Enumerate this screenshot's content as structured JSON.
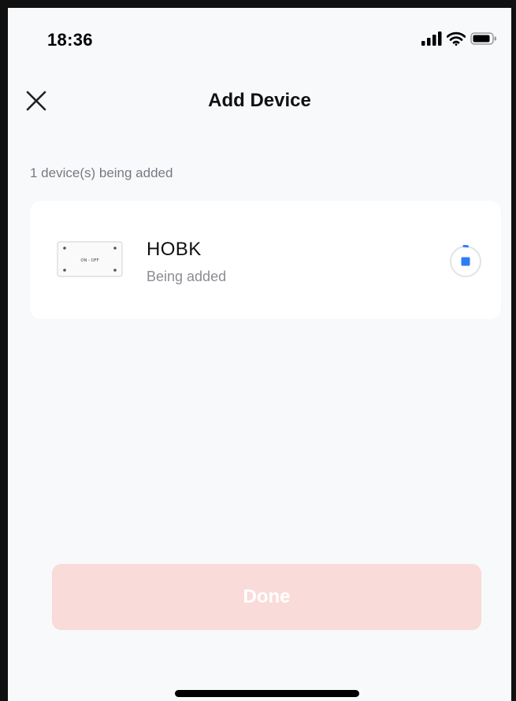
{
  "status_bar": {
    "time": "18:36",
    "icons": [
      "signal-icon",
      "wifi-icon",
      "battery-icon"
    ]
  },
  "header": {
    "title": "Add Device",
    "close_icon": "close-icon"
  },
  "section_label": "1 device(s) being added",
  "device": {
    "name": "HOBK",
    "status": "Being added",
    "thumbnail_label": "ON - OFF",
    "progress_icon": "progress-icon"
  },
  "done_button": {
    "label": "Done",
    "enabled": false
  },
  "colors": {
    "background": "#f8f9fb",
    "card": "#ffffff",
    "accent_blue": "#2f7df6",
    "done_disabled_bg": "#f9dbd9",
    "muted_text": "#8a8d92"
  }
}
